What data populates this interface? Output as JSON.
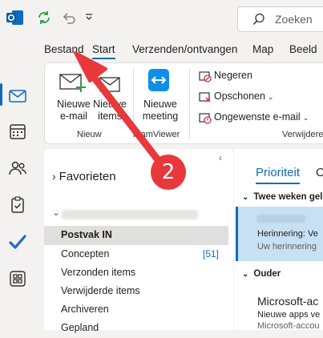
{
  "search": {
    "placeholder": "Zoeken"
  },
  "tabs": [
    "Bestand",
    "Start",
    "Verzenden/ontvangen",
    "Map",
    "Beeld"
  ],
  "ribbon": {
    "new_email": "Nieuwe\ne-mail",
    "new_items": "Nieuwe\nitems",
    "new_meeting": "Nieuwe\nmeeting",
    "group_new": "Nieuw",
    "group_teamviewer": "TeamViewer",
    "ignore": "Negeren",
    "cleanup": "Opschonen",
    "junk": "Ongewenste e-mail",
    "group_delete": "Verwijdere"
  },
  "folders": {
    "favorites": "Favorieten",
    "items": [
      {
        "label": "Postvak IN",
        "count": ""
      },
      {
        "label": "Concepten",
        "count": "[51]"
      },
      {
        "label": "Verzonden items",
        "count": ""
      },
      {
        "label": "Verwijderde items",
        "count": ""
      },
      {
        "label": "Archiveren",
        "count": ""
      },
      {
        "label": "Gepland",
        "count": ""
      }
    ]
  },
  "mail": {
    "tab_priority": "Prioriteit",
    "tab_other": "O",
    "section_two_weeks": "Twee weken gel",
    "section_older": "Ouder",
    "msg1": {
      "subject": "Herinnering: Ve",
      "preview": "Uw herinnering"
    },
    "msg2": {
      "sender": "Microsoft-ac",
      "subject": "Nieuwe apps ve",
      "preview": "Microsoft-accou"
    }
  },
  "annotation": {
    "step": "2"
  },
  "colors": {
    "accent": "#0f6cbd",
    "annotation": "#e8383b"
  }
}
